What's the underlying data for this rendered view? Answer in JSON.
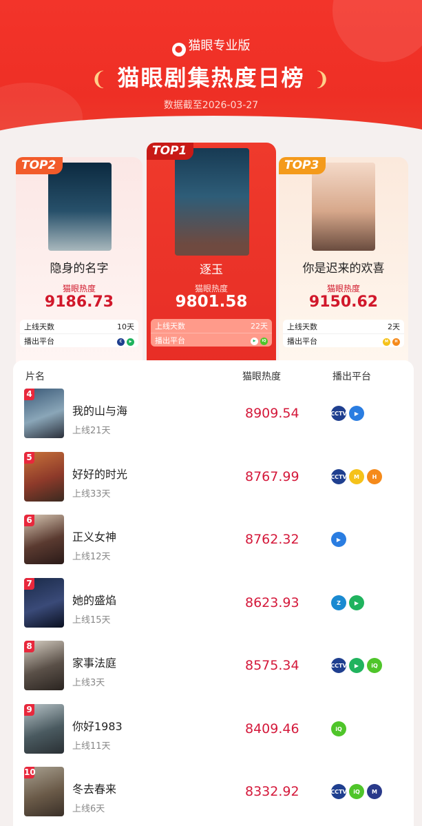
{
  "header": {
    "brand": "猫眼专业版",
    "brand_icon": "cat-eye-logo-icon",
    "title": "猫眼剧集热度日榜",
    "date": "数据截至2026-03-27"
  },
  "top_cards": [
    {
      "badge": "TOP1",
      "name": "逐玉",
      "heat_label": "猫眼热度",
      "heat": "9801.58",
      "days_label": "上线天数",
      "days": "22天",
      "platform_label": "播出平台",
      "platforms": [
        "tencent-video-icon",
        "iqiyi-icon"
      ]
    },
    {
      "badge": "TOP2",
      "name": "隐身的名字",
      "heat_label": "猫眼热度",
      "heat": "9186.73",
      "days_label": "上线天数",
      "days": "10天",
      "platform_label": "播出平台",
      "platforms": [
        "cctv-icon",
        "tencent-video-icon"
      ]
    },
    {
      "badge": "TOP3",
      "name": "你是迟来的欢喜",
      "heat_label": "猫眼热度",
      "heat": "9150.62",
      "days_label": "上线天数",
      "days": "2天",
      "platform_label": "播出平台",
      "platforms": [
        "mango-tv-icon",
        "hunan-tv-icon"
      ]
    }
  ],
  "list": {
    "headers": {
      "name": "片名",
      "heat": "猫眼热度",
      "platform": "播出平台"
    },
    "rows": [
      {
        "rank": "4",
        "name": "我的山与海",
        "days": "上线21天",
        "heat": "8909.54",
        "platforms": [
          "cctv-icon",
          "youku-icon"
        ]
      },
      {
        "rank": "5",
        "name": "好好的时光",
        "days": "上线33天",
        "heat": "8767.99",
        "platforms": [
          "cctv-icon",
          "mango-tv-icon",
          "hunan-tv-icon"
        ]
      },
      {
        "rank": "6",
        "name": "正义女神",
        "days": "上线12天",
        "heat": "8762.32",
        "platforms": [
          "youku-icon"
        ]
      },
      {
        "rank": "7",
        "name": "她的盛焰",
        "days": "上线15天",
        "heat": "8623.93",
        "platforms": [
          "zhejiang-tv-icon",
          "tencent-video-icon"
        ]
      },
      {
        "rank": "8",
        "name": "家事法庭",
        "days": "上线3天",
        "heat": "8575.34",
        "platforms": [
          "cctv-icon",
          "tencent-video-icon",
          "iqiyi-icon"
        ]
      },
      {
        "rank": "9",
        "name": "你好1983",
        "days": "上线11天",
        "heat": "8409.46",
        "platforms": [
          "iqiyi-icon"
        ]
      },
      {
        "rank": "10",
        "name": "冬去春来",
        "days": "上线6天",
        "heat": "8332.92",
        "platforms": [
          "cctv-icon",
          "iqiyi-icon",
          "migu-icon"
        ]
      }
    ]
  },
  "colors": {
    "brand_red": "#ee2f25",
    "heat_red": "#d4183a",
    "top2_badge": "#f25b2a",
    "top3_badge": "#f49a1b"
  }
}
